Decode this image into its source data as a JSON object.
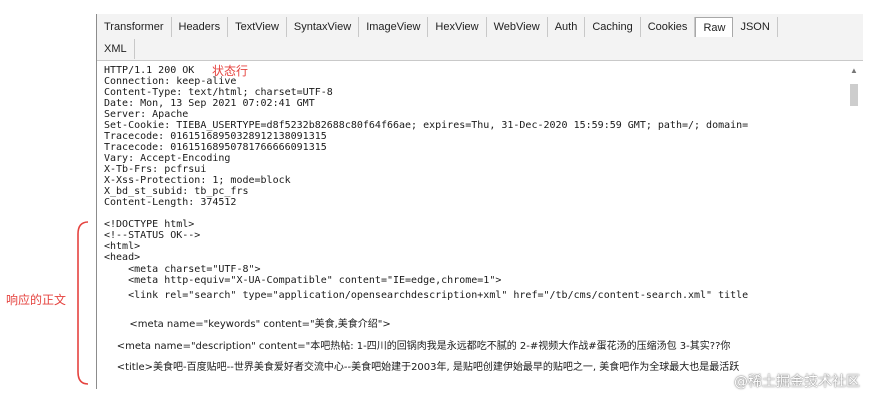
{
  "tabs_row1": [
    "Transformer",
    "Headers",
    "TextView",
    "SyntaxView",
    "ImageView",
    "HexView",
    "WebView",
    "Auth",
    "Caching",
    "Cookies",
    "Raw",
    "JSON"
  ],
  "tabs_row2": [
    "XML"
  ],
  "active_tab": "Raw",
  "annotations": {
    "status_line": "状态行",
    "response_body": "响应的正文"
  },
  "headers": [
    "HTTP/1.1 200 OK",
    "Connection: keep-alive",
    "Content-Type: text/html; charset=UTF-8",
    "Date: Mon, 13 Sep 2021 07:02:41 GMT",
    "Server: Apache",
    "Set-Cookie: TIEBA_USERTYPE=d8f5232b82688c80f64f66ae; expires=Thu, 31-Dec-2020 15:59:59 GMT; path=/; domain=",
    "Tracecode: 01615168950328912138091315",
    "Tracecode: 01615168950781766666091315",
    "Vary: Accept-Encoding",
    "X-Tb-Frs: pcfrsui",
    "X-Xss-Protection: 1; mode=block",
    "X_bd_st_subid: tb_pc_frs",
    "Content-Length: 374512"
  ],
  "body_lines": [
    "<!DOCTYPE html>",
    "<!--STATUS OK-->",
    "<html>",
    "<head>",
    "    <meta charset=\"UTF-8\">",
    "    <meta http-equiv=\"X-UA-Compatible\" content=\"IE=edge,chrome=1\">",
    "    <link rel=\"search\" type=\"application/opensearchdescription+xml\" href=\"/tb/cms/content-search.xml\" title",
    "        <meta name=\"keywords\" content=\"美食,美食介绍\">",
    "    <meta name=\"description\" content=\"本吧热帖: 1-四川的回锅肉我是永远都吃不腻的 2-#视频大作战#蛋花汤的压缩汤包 3-其实??你",
    "    <title>美食吧-百度贴吧--世界美食爱好者交流中心--美食吧始建于2003年, 是贴吧创建伊始最早的贴吧之一, 美食吧作为全球最大也是最活跃"
  ],
  "watermark": "@稀土掘金技术社区"
}
